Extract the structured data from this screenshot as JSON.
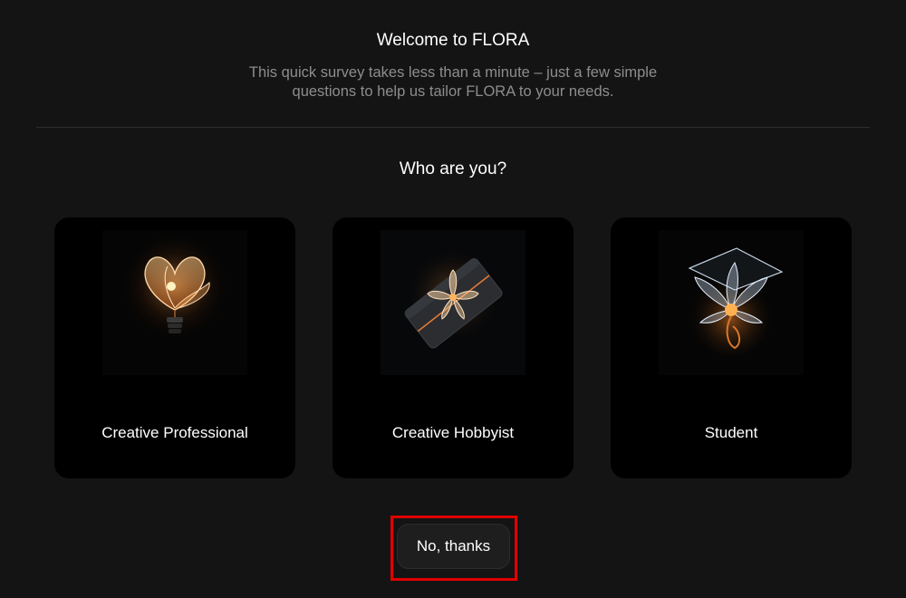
{
  "header": {
    "title": "Welcome to FLORA",
    "subtitle": "This quick survey takes less than a minute – just a few simple questions to help us tailor FLORA to your needs."
  },
  "question": "Who are you?",
  "options": [
    {
      "label": "Creative Professional",
      "icon": "glowing-flower-lightbulb-icon"
    },
    {
      "label": "Creative Hobbyist",
      "icon": "flower-gift-box-icon"
    },
    {
      "label": "Student",
      "icon": "flower-graduation-cap-icon"
    }
  ],
  "dismiss": {
    "label": "No, thanks"
  },
  "colors": {
    "background": "#141414",
    "card": "#000000",
    "subtle_text": "#8d8d8d",
    "glow": "#ff9a3c",
    "highlight": "#e10000"
  }
}
